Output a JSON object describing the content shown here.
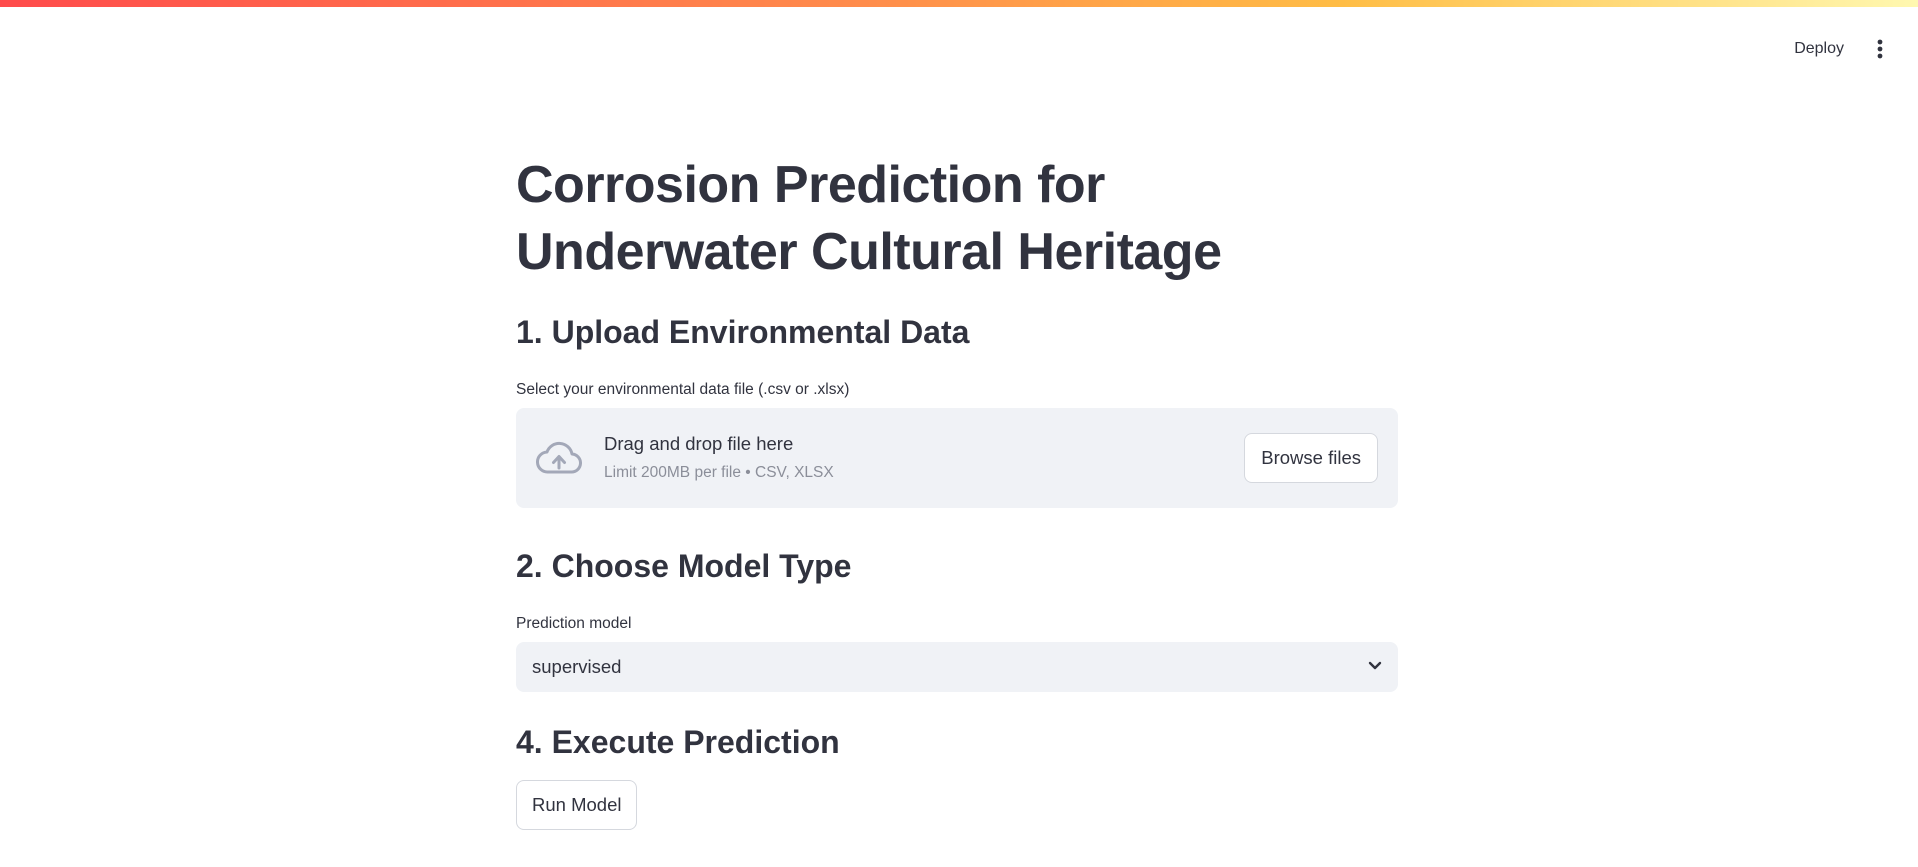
{
  "header": {
    "deploy_label": "Deploy"
  },
  "main": {
    "title_line1": "Corrosion Prediction for",
    "title_line2": "Underwater Cultural Heritage",
    "section1": {
      "heading": "1. Upload Environmental Data",
      "field_label": "Select your environmental data file (.csv or .xlsx)",
      "drop_text": "Drag and drop file here",
      "limit_text": "Limit 200MB per file • CSV, XLSX",
      "browse_label": "Browse files"
    },
    "section2": {
      "heading": "2. Choose Model Type",
      "field_label": "Prediction model",
      "selected_value": "supervised"
    },
    "section4": {
      "heading": "4. Execute Prediction",
      "run_label": "Run Model"
    }
  },
  "colors": {
    "text": "#31333f",
    "muted": "#8b8e99",
    "panel_bg": "#f0f2f6",
    "icon": "#a3a8b8",
    "accent_start": "#ff4b4b",
    "accent_end": "#fff8b0"
  },
  "icons": {
    "menu": "vertical-ellipsis-icon",
    "upload": "cloud-upload-icon",
    "select_chevron": "chevron-down-icon"
  }
}
